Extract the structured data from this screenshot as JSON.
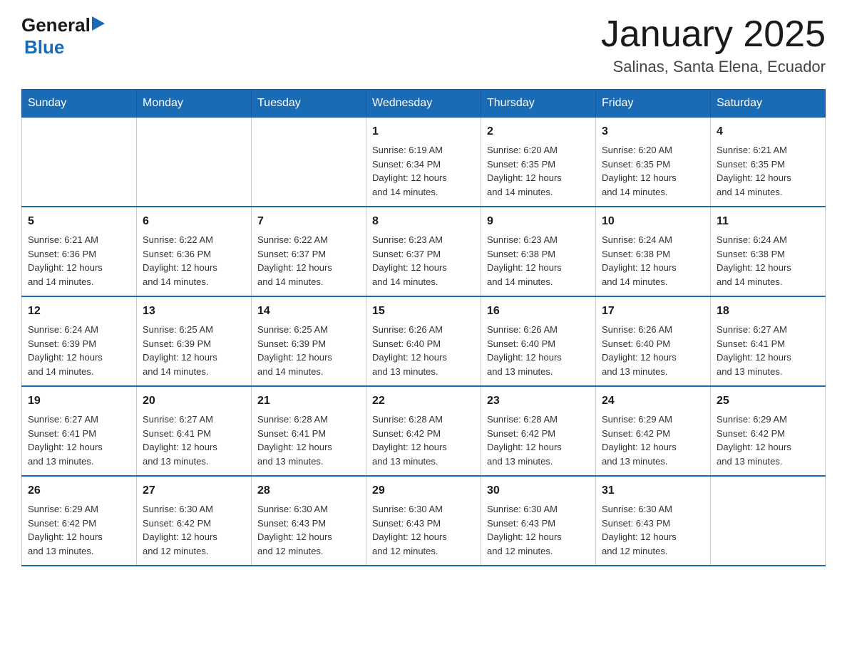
{
  "header": {
    "title": "January 2025",
    "subtitle": "Salinas, Santa Elena, Ecuador",
    "logo_general": "General",
    "logo_blue": "Blue"
  },
  "weekdays": [
    "Sunday",
    "Monday",
    "Tuesday",
    "Wednesday",
    "Thursday",
    "Friday",
    "Saturday"
  ],
  "weeks": [
    [
      {
        "day": "",
        "info": ""
      },
      {
        "day": "",
        "info": ""
      },
      {
        "day": "",
        "info": ""
      },
      {
        "day": "1",
        "info": "Sunrise: 6:19 AM\nSunset: 6:34 PM\nDaylight: 12 hours\nand 14 minutes."
      },
      {
        "day": "2",
        "info": "Sunrise: 6:20 AM\nSunset: 6:35 PM\nDaylight: 12 hours\nand 14 minutes."
      },
      {
        "day": "3",
        "info": "Sunrise: 6:20 AM\nSunset: 6:35 PM\nDaylight: 12 hours\nand 14 minutes."
      },
      {
        "day": "4",
        "info": "Sunrise: 6:21 AM\nSunset: 6:35 PM\nDaylight: 12 hours\nand 14 minutes."
      }
    ],
    [
      {
        "day": "5",
        "info": "Sunrise: 6:21 AM\nSunset: 6:36 PM\nDaylight: 12 hours\nand 14 minutes."
      },
      {
        "day": "6",
        "info": "Sunrise: 6:22 AM\nSunset: 6:36 PM\nDaylight: 12 hours\nand 14 minutes."
      },
      {
        "day": "7",
        "info": "Sunrise: 6:22 AM\nSunset: 6:37 PM\nDaylight: 12 hours\nand 14 minutes."
      },
      {
        "day": "8",
        "info": "Sunrise: 6:23 AM\nSunset: 6:37 PM\nDaylight: 12 hours\nand 14 minutes."
      },
      {
        "day": "9",
        "info": "Sunrise: 6:23 AM\nSunset: 6:38 PM\nDaylight: 12 hours\nand 14 minutes."
      },
      {
        "day": "10",
        "info": "Sunrise: 6:24 AM\nSunset: 6:38 PM\nDaylight: 12 hours\nand 14 minutes."
      },
      {
        "day": "11",
        "info": "Sunrise: 6:24 AM\nSunset: 6:38 PM\nDaylight: 12 hours\nand 14 minutes."
      }
    ],
    [
      {
        "day": "12",
        "info": "Sunrise: 6:24 AM\nSunset: 6:39 PM\nDaylight: 12 hours\nand 14 minutes."
      },
      {
        "day": "13",
        "info": "Sunrise: 6:25 AM\nSunset: 6:39 PM\nDaylight: 12 hours\nand 14 minutes."
      },
      {
        "day": "14",
        "info": "Sunrise: 6:25 AM\nSunset: 6:39 PM\nDaylight: 12 hours\nand 14 minutes."
      },
      {
        "day": "15",
        "info": "Sunrise: 6:26 AM\nSunset: 6:40 PM\nDaylight: 12 hours\nand 13 minutes."
      },
      {
        "day": "16",
        "info": "Sunrise: 6:26 AM\nSunset: 6:40 PM\nDaylight: 12 hours\nand 13 minutes."
      },
      {
        "day": "17",
        "info": "Sunrise: 6:26 AM\nSunset: 6:40 PM\nDaylight: 12 hours\nand 13 minutes."
      },
      {
        "day": "18",
        "info": "Sunrise: 6:27 AM\nSunset: 6:41 PM\nDaylight: 12 hours\nand 13 minutes."
      }
    ],
    [
      {
        "day": "19",
        "info": "Sunrise: 6:27 AM\nSunset: 6:41 PM\nDaylight: 12 hours\nand 13 minutes."
      },
      {
        "day": "20",
        "info": "Sunrise: 6:27 AM\nSunset: 6:41 PM\nDaylight: 12 hours\nand 13 minutes."
      },
      {
        "day": "21",
        "info": "Sunrise: 6:28 AM\nSunset: 6:41 PM\nDaylight: 12 hours\nand 13 minutes."
      },
      {
        "day": "22",
        "info": "Sunrise: 6:28 AM\nSunset: 6:42 PM\nDaylight: 12 hours\nand 13 minutes."
      },
      {
        "day": "23",
        "info": "Sunrise: 6:28 AM\nSunset: 6:42 PM\nDaylight: 12 hours\nand 13 minutes."
      },
      {
        "day": "24",
        "info": "Sunrise: 6:29 AM\nSunset: 6:42 PM\nDaylight: 12 hours\nand 13 minutes."
      },
      {
        "day": "25",
        "info": "Sunrise: 6:29 AM\nSunset: 6:42 PM\nDaylight: 12 hours\nand 13 minutes."
      }
    ],
    [
      {
        "day": "26",
        "info": "Sunrise: 6:29 AM\nSunset: 6:42 PM\nDaylight: 12 hours\nand 13 minutes."
      },
      {
        "day": "27",
        "info": "Sunrise: 6:30 AM\nSunset: 6:42 PM\nDaylight: 12 hours\nand 12 minutes."
      },
      {
        "day": "28",
        "info": "Sunrise: 6:30 AM\nSunset: 6:43 PM\nDaylight: 12 hours\nand 12 minutes."
      },
      {
        "day": "29",
        "info": "Sunrise: 6:30 AM\nSunset: 6:43 PM\nDaylight: 12 hours\nand 12 minutes."
      },
      {
        "day": "30",
        "info": "Sunrise: 6:30 AM\nSunset: 6:43 PM\nDaylight: 12 hours\nand 12 minutes."
      },
      {
        "day": "31",
        "info": "Sunrise: 6:30 AM\nSunset: 6:43 PM\nDaylight: 12 hours\nand 12 minutes."
      },
      {
        "day": "",
        "info": ""
      }
    ]
  ]
}
